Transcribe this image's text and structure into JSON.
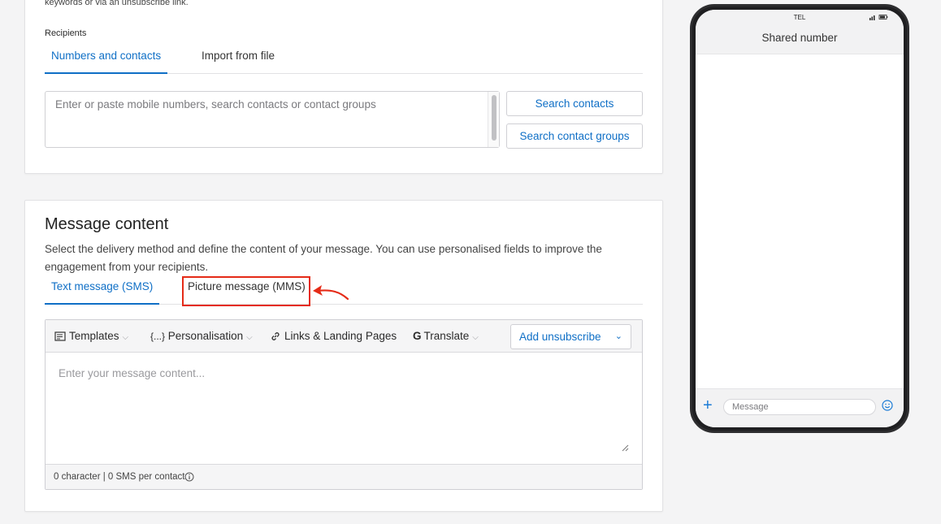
{
  "recipients_section": {
    "intro_text": "keywords or via an unsubscribe link.",
    "label": "Recipients",
    "tabs": [
      {
        "label": "Numbers and contacts",
        "active": true
      },
      {
        "label": "Import from file",
        "active": false
      }
    ],
    "input_placeholder": "Enter or paste mobile numbers, search contacts or contact groups",
    "search_contacts_label": "Search contacts",
    "search_groups_label": "Search contact groups"
  },
  "message_section": {
    "title": "Message content",
    "description": "Select the delivery method and define the content of your message. You can use personalised fields to improve the engagement from your recipients.",
    "tabs": [
      {
        "label": "Text message (SMS)",
        "active": true
      },
      {
        "label": "Picture message (MMS)",
        "active": false
      }
    ],
    "toolbar": {
      "templates": "Templates",
      "personalisation": "Personalisation",
      "links": "Links & Landing Pages",
      "translate": "Translate",
      "add_unsubscribe": "Add unsubscribe"
    },
    "message_placeholder": "Enter your message content...",
    "counter": "0 character | 0 SMS per contact"
  },
  "phone_preview": {
    "carrier": "TEL",
    "title": "Shared number",
    "message_placeholder": "Message"
  },
  "colors": {
    "accent": "#0f6fc6",
    "highlight": "#e52b17",
    "background": "#f4f4f5"
  },
  "icons": [
    "templates-icon",
    "personalisation-icon",
    "link-icon",
    "google-translate-icon",
    "chevron-down-icon",
    "info-icon",
    "plus-icon",
    "emoji-icon",
    "signal-icon",
    "battery-icon"
  ]
}
